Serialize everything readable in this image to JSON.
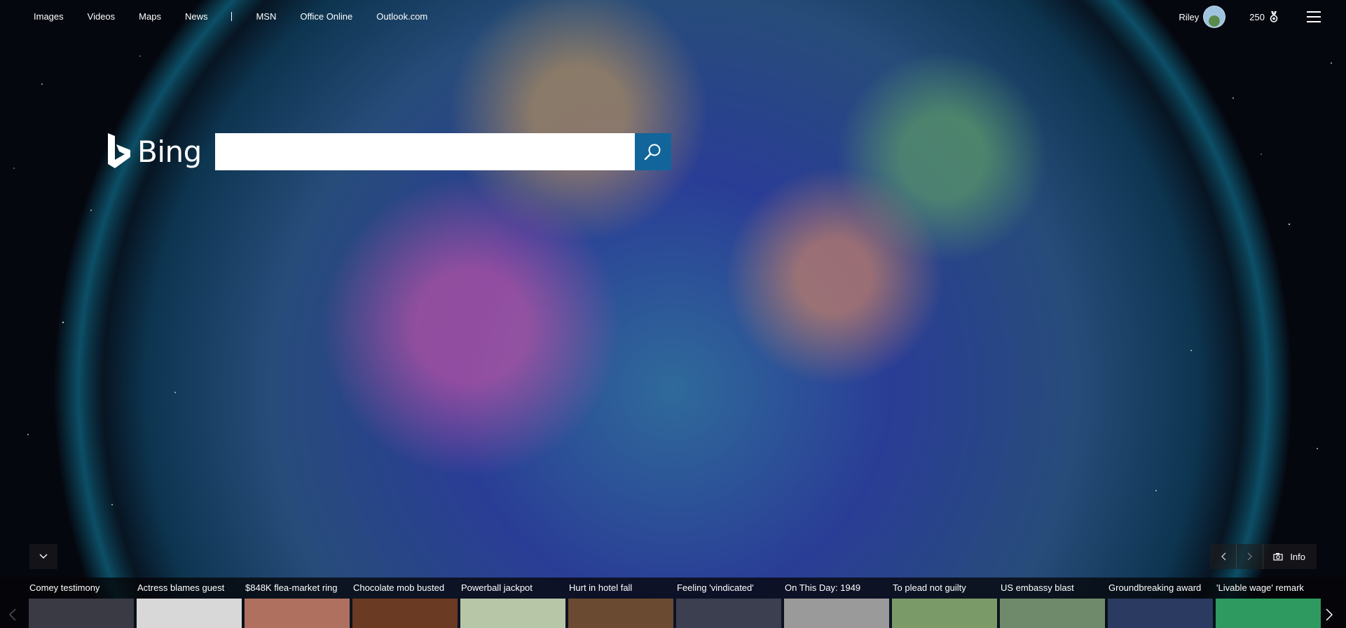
{
  "nav": {
    "links": [
      "Images",
      "Videos",
      "Maps",
      "News"
    ],
    "links2": [
      "MSN",
      "Office Online",
      "Outlook.com"
    ]
  },
  "user": {
    "name": "Riley"
  },
  "rewards": {
    "count": "250"
  },
  "brand": {
    "name": "Bing"
  },
  "search": {
    "value": ""
  },
  "image_controls": {
    "info_label": "Info"
  },
  "news": [
    {
      "label": "Comey testimony",
      "color": "#3a3a44"
    },
    {
      "label": "Actress blames guest",
      "color": "#d8d8d8"
    },
    {
      "label": "$848K flea-market ring",
      "color": "#b07060"
    },
    {
      "label": "Chocolate mob busted",
      "color": "#6b3a22"
    },
    {
      "label": "Powerball jackpot",
      "color": "#b8c6a8"
    },
    {
      "label": "Hurt in hotel fall",
      "color": "#6a4a30"
    },
    {
      "label": "Feeling 'vindicated'",
      "color": "#3b3f50"
    },
    {
      "label": "On This Day: 1949",
      "color": "#9a9a9a"
    },
    {
      "label": "To plead not guilty",
      "color": "#7a9a68"
    },
    {
      "label": "US embassy blast",
      "color": "#6f8a6a"
    },
    {
      "label": "Groundbreaking award",
      "color": "#2a3a60"
    },
    {
      "label": "'Livable wage' remark",
      "color": "#2e9a60"
    }
  ],
  "colors": {
    "search_button": "#11659a"
  }
}
